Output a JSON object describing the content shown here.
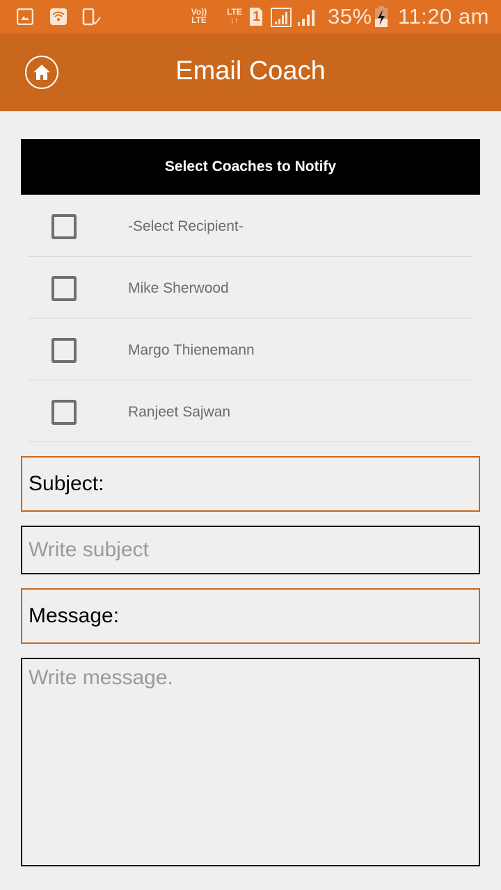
{
  "status_bar": {
    "left_icons": [
      "gallery-icon",
      "wifi-icon",
      "phone-check-icon"
    ],
    "volte_line1": "Vo))",
    "volte_line2": "LTE",
    "lte_label": "LTE",
    "lte_arrows": "↓↑",
    "sim_number": "1",
    "battery_percent": "35%",
    "time": "11:20 am"
  },
  "toolbar": {
    "title": "Email Coach",
    "home_icon": "home-icon"
  },
  "recipients": {
    "header": "Select Coaches to Notify",
    "items": [
      {
        "label": "-Select Recipient-",
        "checked": false
      },
      {
        "label": "Mike Sherwood",
        "checked": false
      },
      {
        "label": "Margo Thienemann",
        "checked": false
      },
      {
        "label": "Ranjeet Sajwan",
        "checked": false
      }
    ]
  },
  "form": {
    "subject_label": "Subject:",
    "subject_value": "",
    "subject_placeholder": "Write subject",
    "message_label": "Message:",
    "message_value": "",
    "message_placeholder": "Write message."
  },
  "colors": {
    "status_bar": "#e07022",
    "toolbar": "#c9671c",
    "accent_border": "#c9671c",
    "background": "#efefef",
    "section_header": "#000000"
  }
}
